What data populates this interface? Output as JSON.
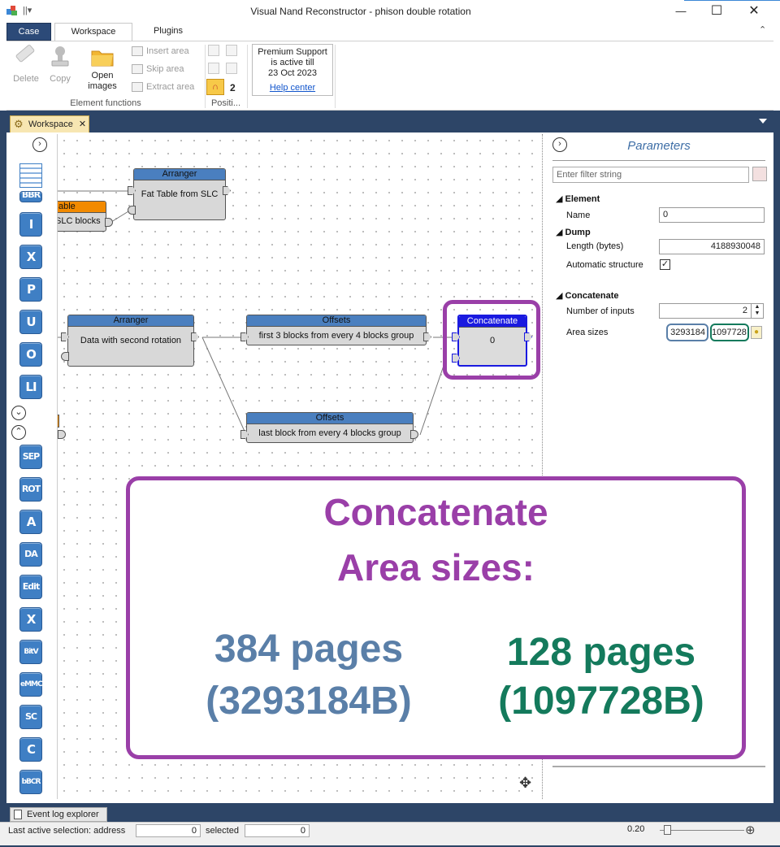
{
  "window": {
    "title": "Visual Nand Reconstructor - phison double rotation",
    "minimize_glyph": "—",
    "maximize_glyph": "☐",
    "close_glyph": "✕",
    "qat_glyph": "||▾"
  },
  "ribbon": {
    "tabs": [
      "Case",
      "Workspace",
      "Plugins"
    ],
    "collapse_glyph": "⌃",
    "delete_label": "Delete",
    "copy_label": "Copy",
    "open_images_label": "Open images",
    "insert_area_label": "Insert area",
    "skip_area_label": "Skip area",
    "extract_area_label": "Extract area",
    "element_functions_label": "Element functions",
    "positions_label": "Positi...",
    "positions_count": "2",
    "premium": {
      "line1": "Premium Support",
      "line2": "is active till",
      "line3": "23 Oct 2023",
      "link": "Help center"
    }
  },
  "doc_tab": {
    "label": "Workspace",
    "close_glyph": "✕"
  },
  "toolbox": {
    "buttons": [
      "I",
      "X",
      "P",
      "U",
      "O",
      "LI",
      "SEP",
      "ROT",
      "A",
      "DA",
      "Edit",
      "X",
      "BitV",
      "eMMC",
      "SC",
      "C",
      "bBCR"
    ],
    "partial_button": "BBR"
  },
  "canvas": {
    "nodes": {
      "fat_table": {
        "header": "Arranger",
        "body": "Fat Table from SLC"
      },
      "orange_node": {
        "header": "able",
        "body": "SLC blocks"
      },
      "arranger2": {
        "header": "Arranger",
        "body": "Data with second rotation"
      },
      "offsets1": {
        "header": "Offsets",
        "body": "first 3 blocks from every 4 blocks group"
      },
      "offsets2": {
        "header": "Offsets",
        "body": "last block from every 4 blocks group"
      },
      "concatenate": {
        "header": "Concatenate",
        "body": "0"
      }
    }
  },
  "parameters": {
    "title": "Parameters",
    "filter_placeholder": "Enter filter string",
    "sections": {
      "element": {
        "title": "Element",
        "name_label": "Name",
        "name_value": "0"
      },
      "dump": {
        "title": "Dump",
        "length_label": "Length (bytes)",
        "length_value": "4188930048",
        "auto_label": "Automatic structure",
        "auto_checked": "✓"
      },
      "concatenate": {
        "title": "Concatenate",
        "inputs_label": "Number of inputs",
        "inputs_value": "2",
        "area_sizes_label": "Area sizes",
        "area_size_1": "3293184",
        "area_size_2": "1097728"
      }
    }
  },
  "overlay": {
    "title_line1": "Concatenate",
    "title_line2": "Area sizes:",
    "left_pages": "384 pages",
    "left_bytes": "(3293184B)",
    "right_pages": "128 pages",
    "right_bytes": "(1097728B)",
    "colors": {
      "border": "#9a3fa8",
      "blue": "#5a7fa8",
      "green": "#147a5c"
    }
  },
  "bottom": {
    "event_log_label": "Event log explorer",
    "status_label": "Last active selection:  address",
    "address_value": "0",
    "selected_label": "selected",
    "selected_value": "0",
    "zoom_value": "0.20",
    "zoom_plus": "⊕"
  }
}
